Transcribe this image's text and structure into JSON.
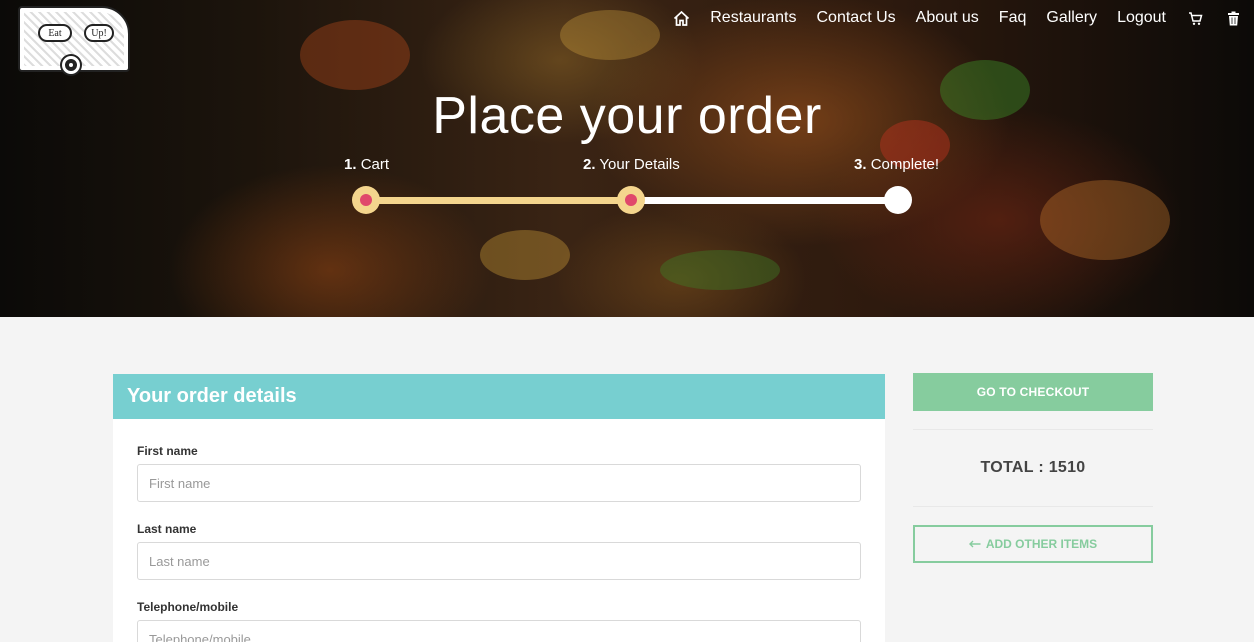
{
  "logo": {
    "text_left": "Eat",
    "text_right": "Up!"
  },
  "nav": {
    "home_icon": "home-icon",
    "items": [
      "Restaurants",
      "Contact Us",
      "About us",
      "Faq",
      "Gallery",
      "Logout"
    ],
    "cart_icon": "cart-icon",
    "trash_icon": "trash-icon"
  },
  "hero": {
    "title": "Place your order",
    "steps": [
      {
        "number": "1.",
        "label": "Cart"
      },
      {
        "number": "2.",
        "label": "Your Details"
      },
      {
        "number": "3.",
        "label": "Complete!"
      }
    ],
    "progress_completed_steps": 2,
    "colors": {
      "track_done": "#f4d58d",
      "dot_center": "#e0476b",
      "track_pending": "#ffffff"
    }
  },
  "order_form": {
    "title": "Your order details",
    "header_color": "#77cfd0",
    "fields": [
      {
        "label": "First name",
        "placeholder": "First name",
        "value": ""
      },
      {
        "label": "Last name",
        "placeholder": "Last name",
        "value": ""
      },
      {
        "label": "Telephone/mobile",
        "placeholder": "Telephone/mobile",
        "value": ""
      }
    ]
  },
  "summary": {
    "checkout_label": "GO TO CHECKOUT",
    "total_text": "TOTAL : 1510",
    "add_items_label": "ADD OTHER ITEMS",
    "add_items_icon": "arrow-left-icon",
    "accent_color": "#86cc9e"
  }
}
